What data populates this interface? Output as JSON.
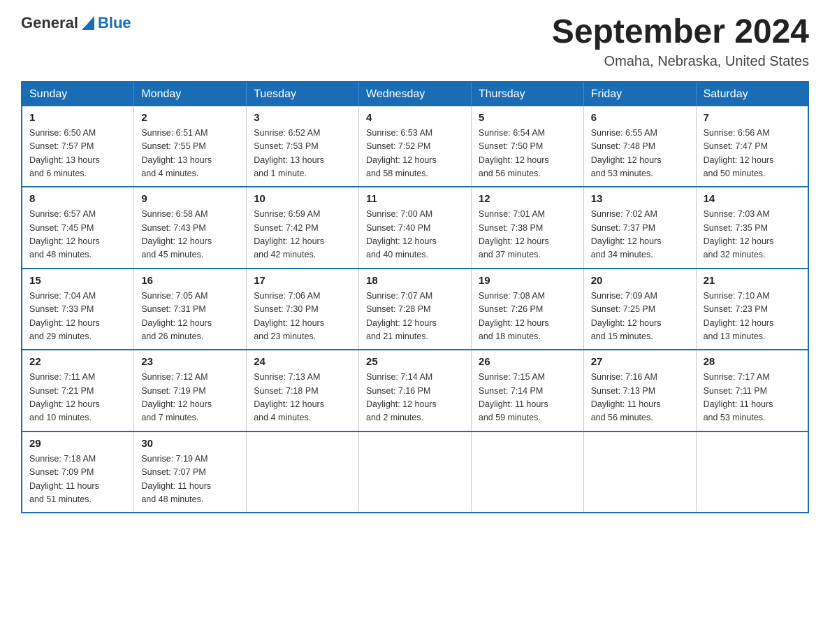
{
  "header": {
    "logo_general": "General",
    "logo_blue": "Blue",
    "title": "September 2024",
    "location": "Omaha, Nebraska, United States"
  },
  "days_of_week": [
    "Sunday",
    "Monday",
    "Tuesday",
    "Wednesday",
    "Thursday",
    "Friday",
    "Saturday"
  ],
  "weeks": [
    [
      {
        "day": "1",
        "sunrise": "6:50 AM",
        "sunset": "7:57 PM",
        "daylight": "13 hours and 6 minutes."
      },
      {
        "day": "2",
        "sunrise": "6:51 AM",
        "sunset": "7:55 PM",
        "daylight": "13 hours and 4 minutes."
      },
      {
        "day": "3",
        "sunrise": "6:52 AM",
        "sunset": "7:53 PM",
        "daylight": "13 hours and 1 minute."
      },
      {
        "day": "4",
        "sunrise": "6:53 AM",
        "sunset": "7:52 PM",
        "daylight": "12 hours and 58 minutes."
      },
      {
        "day": "5",
        "sunrise": "6:54 AM",
        "sunset": "7:50 PM",
        "daylight": "12 hours and 56 minutes."
      },
      {
        "day": "6",
        "sunrise": "6:55 AM",
        "sunset": "7:48 PM",
        "daylight": "12 hours and 53 minutes."
      },
      {
        "day": "7",
        "sunrise": "6:56 AM",
        "sunset": "7:47 PM",
        "daylight": "12 hours and 50 minutes."
      }
    ],
    [
      {
        "day": "8",
        "sunrise": "6:57 AM",
        "sunset": "7:45 PM",
        "daylight": "12 hours and 48 minutes."
      },
      {
        "day": "9",
        "sunrise": "6:58 AM",
        "sunset": "7:43 PM",
        "daylight": "12 hours and 45 minutes."
      },
      {
        "day": "10",
        "sunrise": "6:59 AM",
        "sunset": "7:42 PM",
        "daylight": "12 hours and 42 minutes."
      },
      {
        "day": "11",
        "sunrise": "7:00 AM",
        "sunset": "7:40 PM",
        "daylight": "12 hours and 40 minutes."
      },
      {
        "day": "12",
        "sunrise": "7:01 AM",
        "sunset": "7:38 PM",
        "daylight": "12 hours and 37 minutes."
      },
      {
        "day": "13",
        "sunrise": "7:02 AM",
        "sunset": "7:37 PM",
        "daylight": "12 hours and 34 minutes."
      },
      {
        "day": "14",
        "sunrise": "7:03 AM",
        "sunset": "7:35 PM",
        "daylight": "12 hours and 32 minutes."
      }
    ],
    [
      {
        "day": "15",
        "sunrise": "7:04 AM",
        "sunset": "7:33 PM",
        "daylight": "12 hours and 29 minutes."
      },
      {
        "day": "16",
        "sunrise": "7:05 AM",
        "sunset": "7:31 PM",
        "daylight": "12 hours and 26 minutes."
      },
      {
        "day": "17",
        "sunrise": "7:06 AM",
        "sunset": "7:30 PM",
        "daylight": "12 hours and 23 minutes."
      },
      {
        "day": "18",
        "sunrise": "7:07 AM",
        "sunset": "7:28 PM",
        "daylight": "12 hours and 21 minutes."
      },
      {
        "day": "19",
        "sunrise": "7:08 AM",
        "sunset": "7:26 PM",
        "daylight": "12 hours and 18 minutes."
      },
      {
        "day": "20",
        "sunrise": "7:09 AM",
        "sunset": "7:25 PM",
        "daylight": "12 hours and 15 minutes."
      },
      {
        "day": "21",
        "sunrise": "7:10 AM",
        "sunset": "7:23 PM",
        "daylight": "12 hours and 13 minutes."
      }
    ],
    [
      {
        "day": "22",
        "sunrise": "7:11 AM",
        "sunset": "7:21 PM",
        "daylight": "12 hours and 10 minutes."
      },
      {
        "day": "23",
        "sunrise": "7:12 AM",
        "sunset": "7:19 PM",
        "daylight": "12 hours and 7 minutes."
      },
      {
        "day": "24",
        "sunrise": "7:13 AM",
        "sunset": "7:18 PM",
        "daylight": "12 hours and 4 minutes."
      },
      {
        "day": "25",
        "sunrise": "7:14 AM",
        "sunset": "7:16 PM",
        "daylight": "12 hours and 2 minutes."
      },
      {
        "day": "26",
        "sunrise": "7:15 AM",
        "sunset": "7:14 PM",
        "daylight": "11 hours and 59 minutes."
      },
      {
        "day": "27",
        "sunrise": "7:16 AM",
        "sunset": "7:13 PM",
        "daylight": "11 hours and 56 minutes."
      },
      {
        "day": "28",
        "sunrise": "7:17 AM",
        "sunset": "7:11 PM",
        "daylight": "11 hours and 53 minutes."
      }
    ],
    [
      {
        "day": "29",
        "sunrise": "7:18 AM",
        "sunset": "7:09 PM",
        "daylight": "11 hours and 51 minutes."
      },
      {
        "day": "30",
        "sunrise": "7:19 AM",
        "sunset": "7:07 PM",
        "daylight": "11 hours and 48 minutes."
      },
      null,
      null,
      null,
      null,
      null
    ]
  ],
  "labels": {
    "sunrise": "Sunrise:",
    "sunset": "Sunset:",
    "daylight": "Daylight:"
  }
}
